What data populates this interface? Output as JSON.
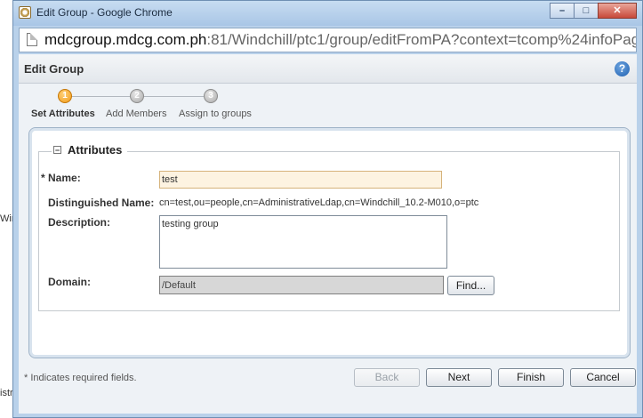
{
  "background": {
    "side_texts": [
      "Win",
      "istr"
    ]
  },
  "window": {
    "title": "Edit Group - Google Chrome",
    "controls": {
      "minimize": "–",
      "maximize": "□",
      "close": "✕"
    }
  },
  "address": {
    "host": "mdcgroup.mdcg.com.ph",
    "rest": ":81/Windchill/ptc1/group/editFromPA?context=tcomp%24infoPage%24("
  },
  "dialog": {
    "title": "Edit Group",
    "help": "?"
  },
  "steps": [
    {
      "number": "1",
      "label": "Set Attributes",
      "active": true
    },
    {
      "number": "2",
      "label": "Add Members",
      "active": false
    },
    {
      "number": "3",
      "label": "Assign to groups",
      "active": false
    }
  ],
  "attributes": {
    "legend": "Attributes",
    "collapse_glyph": "−",
    "name_label": "Name:",
    "required_marker": "*",
    "name_value": "test",
    "dn_label": "Distinguished Name:",
    "dn_value": "cn=test,ou=people,cn=AdministrativeLdap,cn=Windchill_10.2-M010,o=ptc",
    "description_label": "Description:",
    "description_value": "testing group",
    "domain_label": "Domain:",
    "domain_value": "/Default",
    "find_label": "Find..."
  },
  "footer": {
    "note": "* Indicates required fields.",
    "back": "Back",
    "next": "Next",
    "finish": "Finish",
    "cancel": "Cancel"
  }
}
